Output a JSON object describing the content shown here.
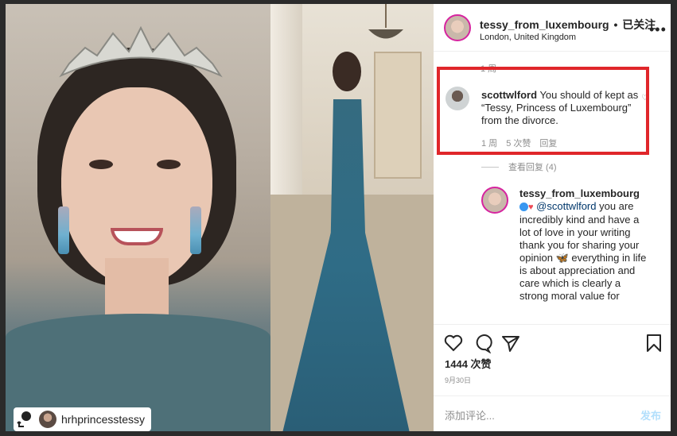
{
  "media": {
    "repost_handle": "hrhprincesstessy"
  },
  "header": {
    "username": "tessy_from_luxembourg",
    "separator": "•",
    "follow_status": "已关注",
    "location": "London, United Kingdom",
    "more_icon": "more-horizontal-icon"
  },
  "comments": {
    "faded_time": "1 周",
    "first": {
      "username": "scottwlford",
      "text": "You should of kept as “Tessy, Princess of Luxembourg” from the divorce.",
      "time": "1 周",
      "likes": "5 次赞",
      "reply": "回复"
    },
    "view_replies": "查看回复 (4)",
    "reply": {
      "username": "tessy_from_luxembourg",
      "mention": "@scottwlford",
      "text_before_emoji": "you are incredibly kind and have a lot of love in your writing thank you for sharing your opinion",
      "emoji": "🦋",
      "text_after_emoji": "everything in life is about appreciation and care which is clearly a strong moral value for"
    }
  },
  "actions": {
    "likes": "1444 次赞",
    "date": "9月30日"
  },
  "comment_box": {
    "placeholder": "添加评论...",
    "post": "发布"
  },
  "colors": {
    "highlight": "#e0262a",
    "link": "#00376b",
    "muted": "#8e8e8e"
  }
}
